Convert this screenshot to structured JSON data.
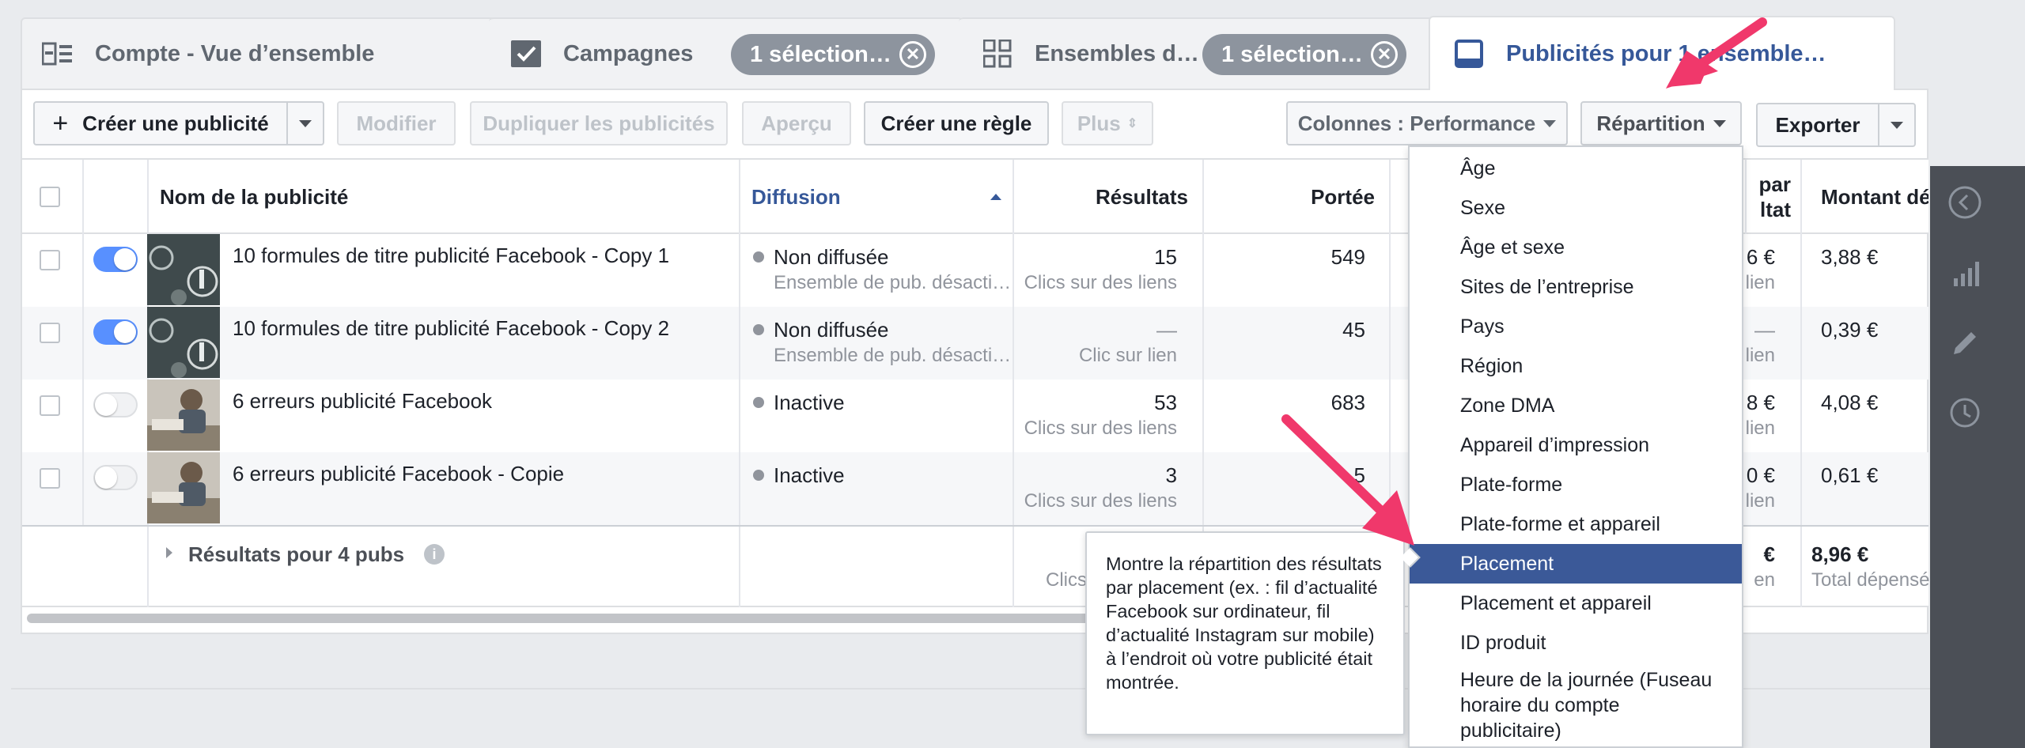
{
  "tabs": [
    {
      "label": "Compte - Vue d’ensemble",
      "icon": "account-overview-icon"
    },
    {
      "label": "Campagnes",
      "icon": "checkbox-icon",
      "selection": "1 sélection…"
    },
    {
      "label": "Ensembles d…",
      "icon": "grid-icon",
      "selection": "1 sélection…"
    },
    {
      "label": "Publicités pour 1 ensemble…",
      "icon": "ad-icon"
    }
  ],
  "toolbar": {
    "create": "Créer une publicité",
    "modify": "Modifier",
    "duplicate": "Dupliquer les publicités",
    "preview": "Aperçu",
    "create_rule": "Créer une règle",
    "more": "Plus",
    "columns": "Colonnes : Performance",
    "breakdown": "Répartition",
    "export": "Exporter"
  },
  "table": {
    "headers": {
      "name": "Nom de la publicité",
      "delivery": "Diffusion",
      "results": "Résultats",
      "reach": "Portée",
      "cost_partial_1": "par",
      "cost_partial_2": "ltat",
      "spent": "Montant dépe"
    },
    "rows": [
      {
        "name": "10 formules de titre publicité Facebook - Copy 1",
        "status": "Non diffusée",
        "status_sub": "Ensemble de pub. désacti…",
        "results": "15",
        "results_sub": "Clics sur des liens",
        "reach": "549",
        "cost": "6 €",
        "cost_sub": "lien",
        "spent": "3,88 €",
        "active": true
      },
      {
        "name": "10 formules de titre publicité Facebook - Copy 2",
        "status": "Non diffusée",
        "status_sub": "Ensemble de pub. désacti…",
        "results": "—",
        "results_sub": "Clic sur lien",
        "reach": "45",
        "cost": "—",
        "cost_sub": "lien",
        "spent": "0,39 €",
        "active": true
      },
      {
        "name": "6 erreurs publicité Facebook",
        "status": "Inactive",
        "status_sub": "",
        "results": "53",
        "results_sub": "Clics sur des liens",
        "reach": "683",
        "cost": "8 €",
        "cost_sub": "lien",
        "spent": "4,08 €",
        "active": false
      },
      {
        "name": "6 erreurs publicité Facebook - Copie",
        "status": "Inactive",
        "status_sub": "",
        "results": "3",
        "results_sub": "Clics sur des liens",
        "reach": "5",
        "cost": "0 €",
        "cost_sub": "lien",
        "spent": "0,61 €",
        "active": false
      }
    ],
    "summary": {
      "label": "Résultats pour 4 pubs",
      "results_sub": "Clics su",
      "cost": "€",
      "cost_sub": "en",
      "spent": "8,96 €",
      "spent_sub": "Total dépensé"
    }
  },
  "breakdown_menu": {
    "items": [
      "Âge",
      "Sexe",
      "Âge et sexe",
      "Sites de l’entreprise",
      "Pays",
      "Région",
      "Zone DMA",
      "Appareil d’impression",
      "Plate-forme",
      "Plate-forme et appareil",
      "Placement",
      "Placement et appareil",
      "ID produit",
      "Heure de la journée (Fuseau horaire du compte publicitaire)"
    ],
    "selected_index": 10
  },
  "tooltip": {
    "text": "Montre la répartition des résultats par placement (ex. : fil d’actualité Facebook sur ordinateur, fil d’actualité Instagram sur mobile) à l’endroit où votre publicité était montrée."
  },
  "colors": {
    "accent": "#3b5998",
    "link_blue": "#365899",
    "toggle_on": "#5890ff",
    "arrow": "#f0386b",
    "sidebar_dark": "#4b4f56"
  }
}
